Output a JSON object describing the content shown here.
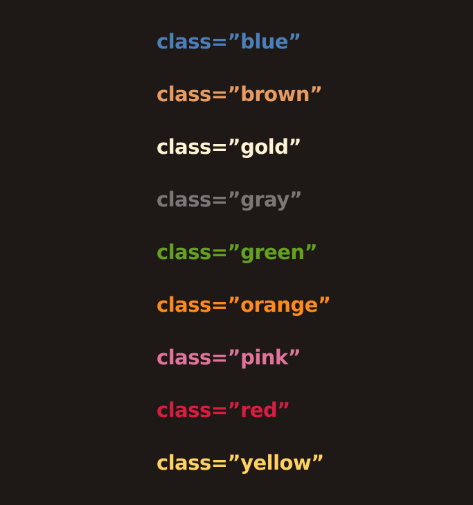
{
  "items": [
    {
      "text": "class=”blue”",
      "color": "#4a7fba"
    },
    {
      "text": "class=”brown”",
      "color": "#e89b62"
    },
    {
      "text": "class=”gold”",
      "color": "#fff3d4"
    },
    {
      "text": "class=”gray”",
      "color": "#7a7877"
    },
    {
      "text": "class=”green”",
      "color": "#64a022"
    },
    {
      "text": "class=”orange”",
      "color": "#ff8a1c"
    },
    {
      "text": "class=”pink”",
      "color": "#e2739a"
    },
    {
      "text": "class=”red”",
      "color": "#d81d41"
    },
    {
      "text": "class=”yellow”",
      "color": "#ffd062"
    }
  ]
}
